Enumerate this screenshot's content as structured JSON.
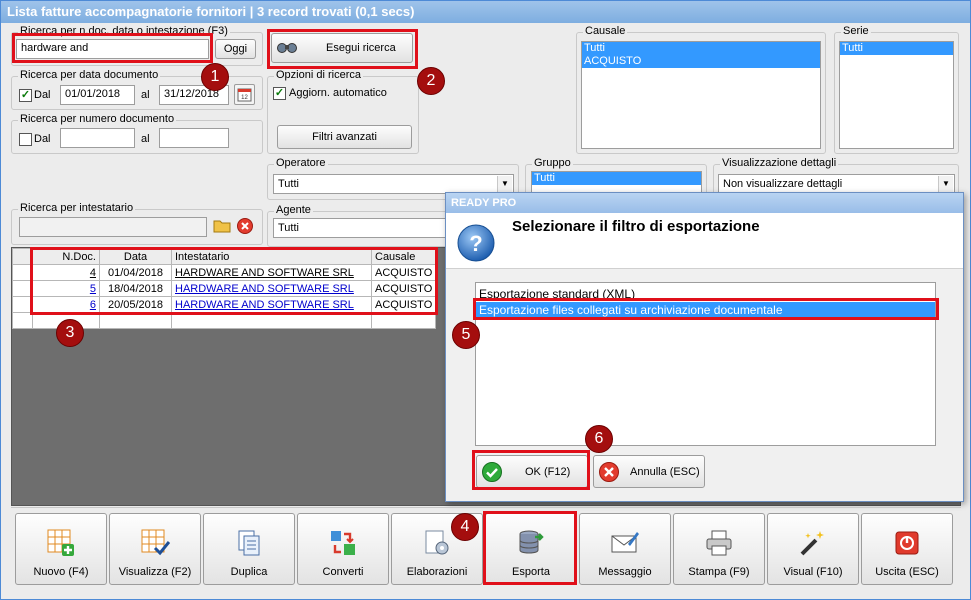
{
  "window": {
    "title": "Lista fatture accompagnatorie fornitori | 3 record trovati (0,1 secs)"
  },
  "search_text": {
    "label": "Ricerca per n.doc, data o intestazione (F3)",
    "value": "hardware and",
    "today_label": "Oggi"
  },
  "search_date": {
    "label": "Ricerca per data documento",
    "dal_label": "Dal",
    "from": "01/01/2018",
    "al_label": "al",
    "to": "31/12/2018"
  },
  "search_number": {
    "label": "Ricerca per numero documento",
    "dal_label": "Dal",
    "from": "",
    "al_label": "al",
    "to": ""
  },
  "search_holder": {
    "label": "Ricerca per intestatario",
    "value": ""
  },
  "execute_search": {
    "label": "Esegui ricerca"
  },
  "options": {
    "label": "Opzioni di ricerca",
    "auto_update_label": "Aggiorn. automatico",
    "advanced_filters_label": "Filtri avanzati"
  },
  "operatore": {
    "label": "Operatore",
    "value": "Tutti"
  },
  "agente": {
    "label": "Agente",
    "value": "Tutti"
  },
  "causale": {
    "label": "Causale",
    "items": [
      "Tutti",
      "ACQUISTO"
    ]
  },
  "serie": {
    "label": "Serie",
    "items": [
      "Tutti"
    ]
  },
  "gruppo": {
    "label": "Gruppo",
    "items": [
      "Tutti"
    ]
  },
  "details": {
    "label": "Visualizzazione dettagli",
    "value": "Non visualizzare dettagli"
  },
  "grid": {
    "headers": [
      "N.Doc.",
      "Data",
      "Intestatario",
      "Causale"
    ],
    "rows": [
      {
        "num": "4",
        "date": "01/04/2018",
        "holder": "HARDWARE AND SOFTWARE SRL",
        "causale": "ACQUISTO"
      },
      {
        "num": "5",
        "date": "18/04/2018",
        "holder": "HARDWARE AND SOFTWARE SRL",
        "causale": "ACQUISTO"
      },
      {
        "num": "6",
        "date": "20/05/2018",
        "holder": "HARDWARE AND SOFTWARE SRL",
        "causale": "ACQUISTO"
      }
    ]
  },
  "dialog": {
    "title": "READY PRO",
    "heading": "Selezionare il filtro di esportazione",
    "options": [
      "Esportazione standard (XML)",
      "Esportazione files collegati su archiviazione documentale"
    ],
    "selected_index": 1,
    "ok_label": "OK (F12)",
    "cancel_label": "Annulla (ESC)"
  },
  "toolbar": [
    {
      "label": "Nuovo (F4)",
      "icon": "grid-add-icon"
    },
    {
      "label": "Visualizza (F2)",
      "icon": "grid-check-icon"
    },
    {
      "label": "Duplica",
      "icon": "duplicate-icon"
    },
    {
      "label": "Converti",
      "icon": "convert-icon"
    },
    {
      "label": "Elaborazioni",
      "icon": "process-icon"
    },
    {
      "label": "Esporta",
      "icon": "database-export-icon"
    },
    {
      "label": "Messaggio",
      "icon": "message-icon"
    },
    {
      "label": "Stampa (F9)",
      "icon": "printer-icon"
    },
    {
      "label": "Visual (F10)",
      "icon": "magic-wand-icon"
    },
    {
      "label": "Uscita (ESC)",
      "icon": "exit-icon"
    }
  ],
  "markers": [
    "1",
    "2",
    "3",
    "4",
    "5",
    "6"
  ],
  "colors": {
    "highlight_red": "#e0101a",
    "selection_blue": "#3399ff",
    "badge": "#a40e0e"
  }
}
